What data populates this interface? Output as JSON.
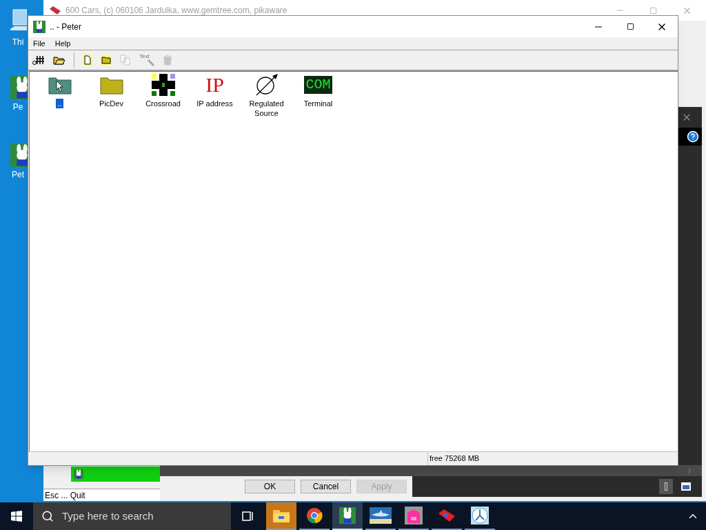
{
  "desktop_icons": [
    {
      "label": "Thi"
    },
    {
      "label": "Pe"
    },
    {
      "label": "Pet"
    }
  ],
  "back_window": {
    "title": "600 Cars, (c) 060106 Jardulka, www.gemtree.com, pikaware",
    "status": "Esc ... Quit"
  },
  "dialog": {
    "buttons": [
      {
        "label": "OK",
        "disabled": false
      },
      {
        "label": "Cancel",
        "disabled": false
      },
      {
        "label": "Apply",
        "disabled": true
      }
    ]
  },
  "window": {
    "title": ".. - Peter",
    "menu": [
      "File",
      "Help"
    ],
    "toolbar": [
      {
        "kind": "tree",
        "disabled": false
      },
      {
        "kind": "open",
        "disabled": false
      },
      {
        "kind": "new",
        "disabled": false
      },
      {
        "kind": "folder",
        "disabled": false
      },
      {
        "kind": "copy",
        "disabled": true
      },
      {
        "kind": "text",
        "label": "Text",
        "disabled": true
      },
      {
        "kind": "delete",
        "disabled": true
      }
    ],
    "items": [
      {
        "kind": "up",
        "label": "..",
        "selected": true
      },
      {
        "kind": "folder",
        "label": "PicDev",
        "selected": false
      },
      {
        "kind": "crossroad",
        "label": "Crossroad",
        "selected": false
      },
      {
        "kind": "ip",
        "icon_text": "IP",
        "label": "IP address",
        "selected": false
      },
      {
        "kind": "source",
        "label": "Regulated Source",
        "selected": false
      },
      {
        "kind": "terminal",
        "icon_text": "COM",
        "label": "Terminal",
        "selected": false
      }
    ],
    "status_bar": {
      "free_space": "free 75268 MB"
    }
  },
  "taskbar": {
    "search_placeholder": "Type here to search",
    "apps": [
      {
        "kind": "explorer",
        "highlighted": true,
        "active": false
      },
      {
        "kind": "chrome",
        "highlighted": false,
        "active": false
      },
      {
        "kind": "peter",
        "highlighted": false,
        "active": true
      },
      {
        "kind": "shark",
        "highlighted": false,
        "active": false
      },
      {
        "kind": "bag",
        "highlighted": false,
        "active": false
      },
      {
        "kind": "car",
        "highlighted": false,
        "active": false
      },
      {
        "kind": "clock",
        "highlighted": false,
        "active": false
      }
    ]
  }
}
